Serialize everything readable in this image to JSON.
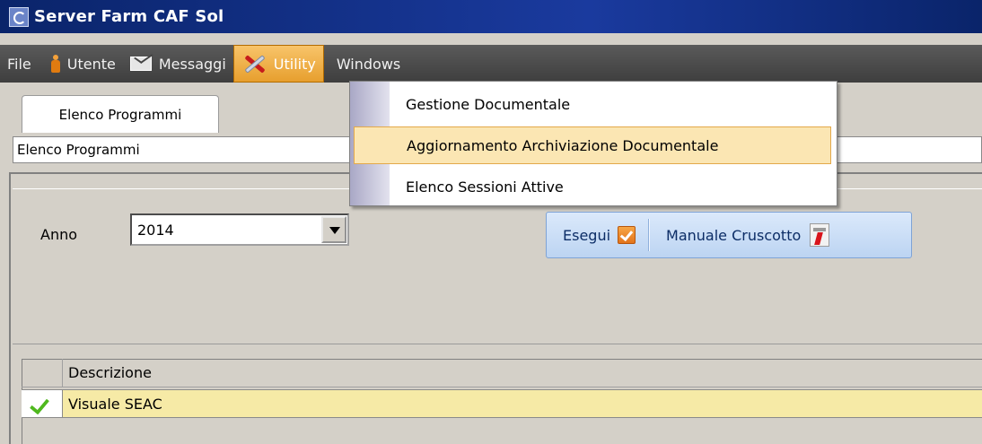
{
  "window": {
    "title": "Server Farm CAF Sol"
  },
  "menubar": {
    "items": [
      {
        "label": "File",
        "icon": null
      },
      {
        "label": "Utente",
        "icon": "user-icon"
      },
      {
        "label": "Messaggi",
        "icon": "mail-icon"
      },
      {
        "label": "Utility",
        "icon": "tools-icon",
        "open": true
      },
      {
        "label": "Windows",
        "icon": null
      }
    ]
  },
  "utility_menu": {
    "items": [
      {
        "label": "Gestione Documentale"
      },
      {
        "label": "Aggiornamento Archiviazione Documentale",
        "highlighted": true
      },
      {
        "label": "Elenco Sessioni Attive"
      }
    ]
  },
  "tab": {
    "label": "Elenco Programmi"
  },
  "path_field": {
    "value": "Elenco Programmi"
  },
  "filters": {
    "anno_label": "Anno",
    "anno_value": "2014"
  },
  "actions": {
    "esegui_label": "Esegui",
    "manuale_label": "Manuale Cruscotto"
  },
  "grid": {
    "columns": [
      "Descrizione"
    ],
    "rows": [
      {
        "descrizione": "Visuale SEAC",
        "checked": true,
        "selected": true
      }
    ]
  },
  "colors": {
    "titlebar": "#0a246a",
    "menubar": "#4a4a4a",
    "menu_open": "#e79f2e",
    "row_selected": "#f6eaa6",
    "action_bar": "#cfe0f7"
  }
}
